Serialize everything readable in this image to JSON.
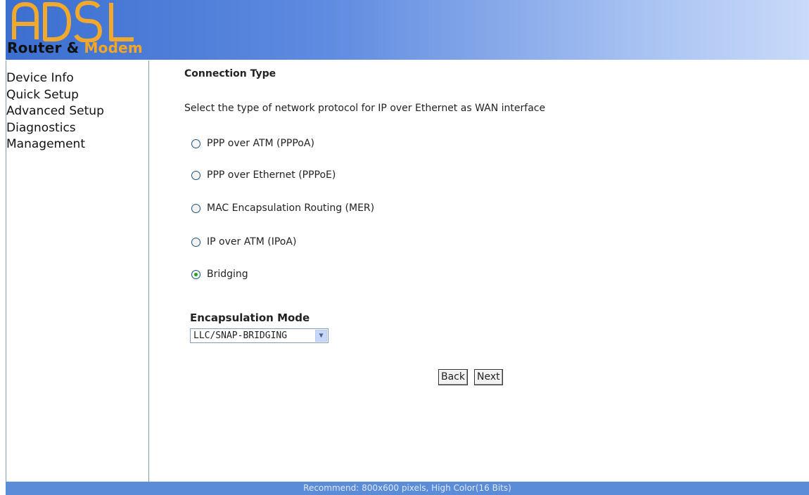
{
  "logo": {
    "word": "ADSL",
    "caption_part1": "Router & ",
    "caption_part2": "Modem"
  },
  "sidebar": {
    "items": [
      {
        "label": "Device Info"
      },
      {
        "label": "Quick Setup"
      },
      {
        "label": "Advanced Setup"
      },
      {
        "label": "Diagnostics"
      },
      {
        "label": "Management"
      }
    ]
  },
  "main": {
    "heading": "Connection Type",
    "description": "Select the type of network protocol for IP over Ethernet as WAN interface",
    "options": [
      {
        "label": "PPP over ATM (PPPoA)",
        "checked": false
      },
      {
        "label": "PPP over Ethernet (PPPoE)",
        "checked": false
      },
      {
        "label": "MAC Encapsulation Routing (MER)",
        "checked": false
      },
      {
        "label": "IP over ATM (IPoA)",
        "checked": false
      },
      {
        "label": "Bridging",
        "checked": true
      }
    ],
    "encapsulation_label": "Encapsulation Mode",
    "encapsulation_value": "LLC/SNAP-BRIDGING",
    "back_label": "Back",
    "next_label": "Next"
  },
  "footer": {
    "text": "Recommend: 800x600 pixels, High Color(16 Bits)"
  },
  "colors": {
    "header_blue": "#3b6fd0",
    "footer_blue": "#5b8cd8",
    "modem_orange": "#f6a623"
  }
}
